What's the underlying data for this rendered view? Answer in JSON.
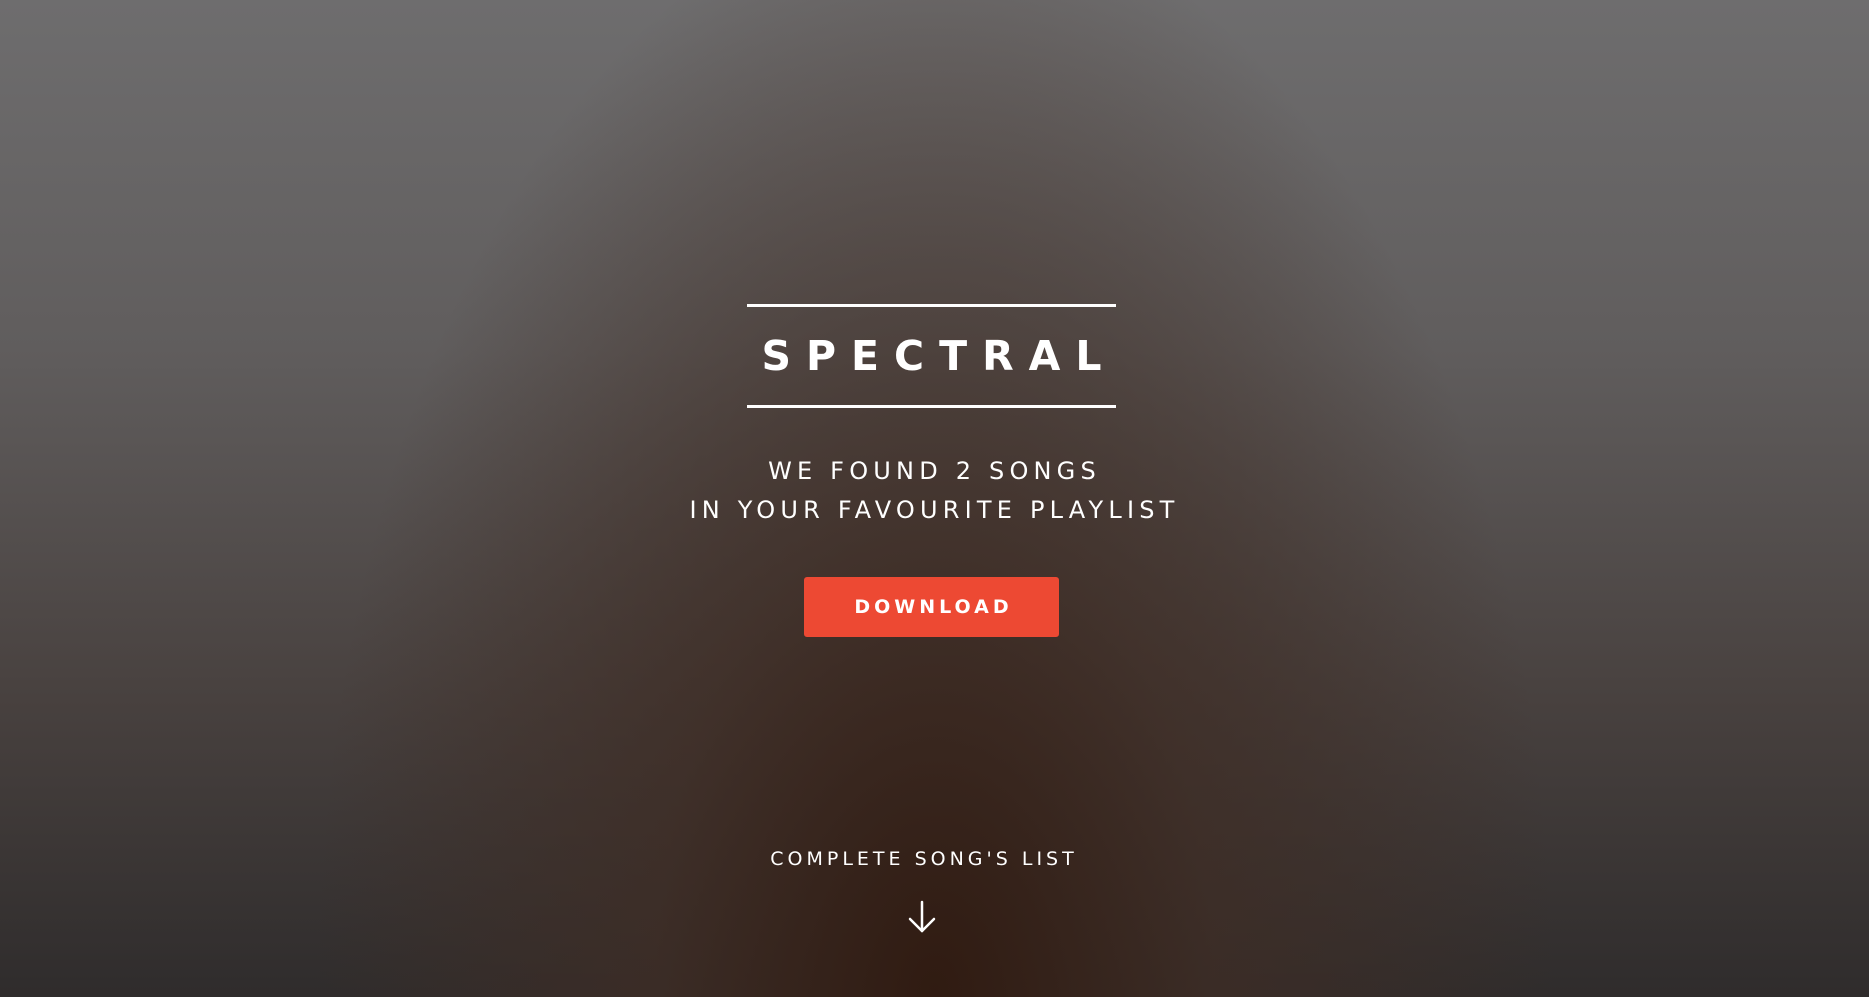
{
  "banner": {
    "logo": "SPECTRAL",
    "tagline_line1": "WE FOUND 2 SONGS",
    "tagline_line2": "IN YOUR FAVOURITE PLAYLIST",
    "download_label": "DOWNLOAD",
    "more_label": "COMPLETE SONG'S LIST",
    "more_icon": "arrow-down-icon"
  },
  "colors": {
    "accent": "#ed4933",
    "text": "#ffffff"
  }
}
